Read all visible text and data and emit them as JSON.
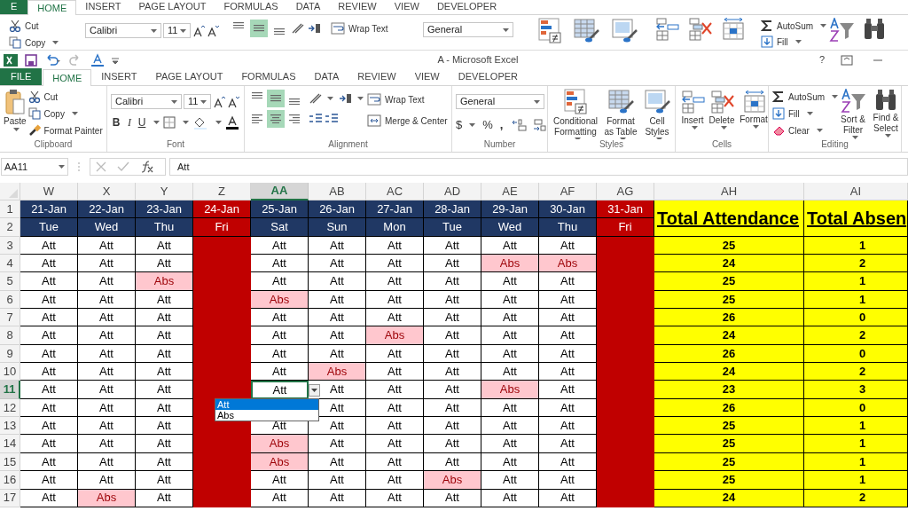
{
  "background_window": {
    "tabs": [
      {
        "label": "E",
        "kind": "file",
        "selected": false
      },
      {
        "label": "HOME",
        "selected": true
      },
      {
        "label": "INSERT",
        "selected": false
      },
      {
        "label": "PAGE LAYOUT",
        "selected": false
      },
      {
        "label": "FORMULAS",
        "selected": false
      },
      {
        "label": "DATA",
        "selected": false
      },
      {
        "label": "REVIEW",
        "selected": false
      },
      {
        "label": "VIEW",
        "selected": false
      },
      {
        "label": "DEVELOPER",
        "selected": false
      }
    ],
    "cut": "Cut",
    "copy": "Copy",
    "font_name": "Calibri",
    "font_size": "11",
    "wrap_text": "Wrap Text",
    "number_format": "General",
    "autosum": "AutoSum",
    "fill": "Fill"
  },
  "title_bar": {
    "title": "A - Microsoft Excel",
    "help": "?"
  },
  "ribbon": {
    "tabs": [
      {
        "label": "FILE",
        "kind": "file",
        "selected": false
      },
      {
        "label": "HOME",
        "selected": true
      },
      {
        "label": "INSERT",
        "selected": false
      },
      {
        "label": "PAGE LAYOUT",
        "selected": false
      },
      {
        "label": "FORMULAS",
        "selected": false
      },
      {
        "label": "DATA",
        "selected": false
      },
      {
        "label": "REVIEW",
        "selected": false
      },
      {
        "label": "VIEW",
        "selected": false
      },
      {
        "label": "DEVELOPER",
        "selected": false
      }
    ],
    "clipboard": {
      "label": "Clipboard",
      "paste": "Paste",
      "cut": "Cut",
      "copy": "Copy",
      "format_painter": "Format Painter"
    },
    "font": {
      "label": "Font",
      "font_name": "Calibri",
      "font_size": "11",
      "bold": "B",
      "italic": "I",
      "underline": "U"
    },
    "alignment": {
      "label": "Alignment",
      "wrap_text": "Wrap Text",
      "merge_center": "Merge & Center",
      "align_buttons": [
        {
          "kind": "top",
          "selected": false
        },
        {
          "kind": "middle",
          "selected": true
        },
        {
          "kind": "bottom",
          "selected": false
        },
        {
          "kind": "left",
          "selected": false
        },
        {
          "kind": "center",
          "selected": true
        },
        {
          "kind": "right",
          "selected": false
        }
      ]
    },
    "number": {
      "label": "Number",
      "format": "General",
      "currency": "$",
      "percent": "%",
      "comma": ","
    },
    "styles": {
      "label": "Styles",
      "conditional_formatting": "Conditional Formatting",
      "format_as_table": "Format as Table",
      "cell_styles": "Cell Styles"
    },
    "cells": {
      "label": "Cells",
      "insert": "Insert",
      "delete": "Delete",
      "format": "Format"
    },
    "editing": {
      "label": "Editing",
      "autosum": "AutoSum",
      "fill": "Fill",
      "clear": "Clear",
      "sort_filter": "Sort & Filter",
      "find_select": "Find & Select"
    }
  },
  "formula_bar": {
    "name_box": "AA11",
    "value": "Att"
  },
  "sheet": {
    "columns": [
      {
        "letter": "W",
        "date": "21-Jan",
        "day": "Tue",
        "holiday": false,
        "selected": false
      },
      {
        "letter": "X",
        "date": "22-Jan",
        "day": "Wed",
        "holiday": false,
        "selected": false
      },
      {
        "letter": "Y",
        "date": "23-Jan",
        "day": "Thu",
        "holiday": false,
        "selected": false
      },
      {
        "letter": "Z",
        "date": "24-Jan",
        "day": "Fri",
        "holiday": true,
        "selected": false
      },
      {
        "letter": "AA",
        "date": "25-Jan",
        "day": "Sat",
        "holiday": false,
        "selected": true
      },
      {
        "letter": "AB",
        "date": "26-Jan",
        "day": "Sun",
        "holiday": false,
        "selected": false
      },
      {
        "letter": "AC",
        "date": "27-Jan",
        "day": "Mon",
        "holiday": false,
        "selected": false
      },
      {
        "letter": "AD",
        "date": "28-Jan",
        "day": "Tue",
        "holiday": false,
        "selected": false
      },
      {
        "letter": "AE",
        "date": "29-Jan",
        "day": "Wed",
        "holiday": false,
        "selected": false
      },
      {
        "letter": "AF",
        "date": "30-Jan",
        "day": "Thu",
        "holiday": false,
        "selected": false
      },
      {
        "letter": "AG",
        "date": "31-Jan",
        "day": "Fri",
        "holiday": true,
        "selected": false
      }
    ],
    "total_columns": [
      {
        "letter": "AH",
        "title": "Total Attendance"
      },
      {
        "letter": "AI",
        "title": "Total Absen"
      }
    ],
    "header_row_numbers": [
      "1",
      "2"
    ],
    "rows": [
      {
        "number": "3",
        "selected": false,
        "cells": [
          "Att",
          "Att",
          "Att",
          "",
          "Att",
          "Att",
          "Att",
          "Att",
          "Att",
          "Att",
          ""
        ],
        "highlighted": [
          false,
          false,
          false,
          false,
          false,
          false,
          false,
          false,
          false,
          false,
          false
        ],
        "total_attendance": "25",
        "total_absent": "1"
      },
      {
        "number": "4",
        "selected": false,
        "cells": [
          "Att",
          "Att",
          "Att",
          "",
          "Att",
          "Att",
          "Att",
          "Att",
          "Abs",
          "Abs",
          ""
        ],
        "highlighted": [
          false,
          false,
          false,
          false,
          false,
          false,
          false,
          false,
          true,
          true,
          false
        ],
        "total_attendance": "24",
        "total_absent": "2"
      },
      {
        "number": "5",
        "selected": false,
        "cells": [
          "Att",
          "Att",
          "Abs",
          "",
          "Att",
          "Att",
          "Att",
          "Att",
          "Att",
          "Att",
          ""
        ],
        "highlighted": [
          false,
          false,
          true,
          false,
          false,
          false,
          false,
          false,
          false,
          false,
          false
        ],
        "total_attendance": "25",
        "total_absent": "1"
      },
      {
        "number": "6",
        "selected": false,
        "cells": [
          "Att",
          "Att",
          "Att",
          "",
          "Abs",
          "Att",
          "Att",
          "Att",
          "Att",
          "Att",
          ""
        ],
        "highlighted": [
          false,
          false,
          false,
          false,
          true,
          false,
          false,
          false,
          false,
          false,
          false
        ],
        "total_attendance": "25",
        "total_absent": "1"
      },
      {
        "number": "7",
        "selected": false,
        "cells": [
          "Att",
          "Att",
          "Att",
          "",
          "Att",
          "Att",
          "Att",
          "Att",
          "Att",
          "Att",
          ""
        ],
        "highlighted": [
          false,
          false,
          false,
          false,
          false,
          false,
          false,
          false,
          false,
          false,
          false
        ],
        "total_attendance": "26",
        "total_absent": "0"
      },
      {
        "number": "8",
        "selected": false,
        "cells": [
          "Att",
          "Att",
          "Att",
          "",
          "Att",
          "Att",
          "Abs",
          "Att",
          "Att",
          "Att",
          ""
        ],
        "highlighted": [
          false,
          false,
          false,
          false,
          false,
          false,
          true,
          false,
          false,
          false,
          false
        ],
        "total_attendance": "24",
        "total_absent": "2"
      },
      {
        "number": "9",
        "selected": false,
        "cells": [
          "Att",
          "Att",
          "Att",
          "",
          "Att",
          "Att",
          "Att",
          "Att",
          "Att",
          "Att",
          ""
        ],
        "highlighted": [
          false,
          false,
          false,
          false,
          false,
          false,
          false,
          false,
          false,
          false,
          false
        ],
        "total_attendance": "26",
        "total_absent": "0"
      },
      {
        "number": "10",
        "selected": false,
        "cells": [
          "Att",
          "Att",
          "Att",
          "",
          "Att",
          "Abs",
          "Att",
          "Att",
          "Att",
          "Att",
          ""
        ],
        "highlighted": [
          false,
          false,
          false,
          false,
          false,
          true,
          false,
          false,
          false,
          false,
          false
        ],
        "total_attendance": "24",
        "total_absent": "2"
      },
      {
        "number": "11",
        "selected": true,
        "cells": [
          "Att",
          "Att",
          "Att",
          "",
          "Att",
          "Att",
          "Att",
          "Att",
          "Abs",
          "Att",
          ""
        ],
        "highlighted": [
          false,
          false,
          false,
          false,
          false,
          false,
          false,
          false,
          true,
          false,
          false
        ],
        "total_attendance": "23",
        "total_absent": "3"
      },
      {
        "number": "12",
        "selected": false,
        "cells": [
          "Att",
          "Att",
          "Att",
          "",
          "",
          "Att",
          "Att",
          "Att",
          "Att",
          "Att",
          ""
        ],
        "highlighted": [
          false,
          false,
          false,
          false,
          false,
          false,
          false,
          false,
          false,
          false,
          false
        ],
        "total_attendance": "26",
        "total_absent": "0"
      },
      {
        "number": "13",
        "selected": false,
        "cells": [
          "Att",
          "Att",
          "Att",
          "",
          "Att",
          "Att",
          "Att",
          "Att",
          "Att",
          "Att",
          ""
        ],
        "highlighted": [
          false,
          false,
          false,
          false,
          false,
          false,
          false,
          false,
          false,
          false,
          false
        ],
        "total_attendance": "25",
        "total_absent": "1"
      },
      {
        "number": "14",
        "selected": false,
        "cells": [
          "Att",
          "Att",
          "Att",
          "",
          "Abs",
          "Att",
          "Att",
          "Att",
          "Att",
          "Att",
          ""
        ],
        "highlighted": [
          false,
          false,
          false,
          false,
          true,
          false,
          false,
          false,
          false,
          false,
          false
        ],
        "total_attendance": "25",
        "total_absent": "1"
      },
      {
        "number": "15",
        "selected": false,
        "cells": [
          "Att",
          "Att",
          "Att",
          "",
          "Abs",
          "Att",
          "Att",
          "Att",
          "Att",
          "Att",
          ""
        ],
        "highlighted": [
          false,
          false,
          false,
          false,
          true,
          false,
          false,
          false,
          false,
          false,
          false
        ],
        "total_attendance": "25",
        "total_absent": "1"
      },
      {
        "number": "16",
        "selected": false,
        "cells": [
          "Att",
          "Att",
          "Att",
          "",
          "Att",
          "Att",
          "Att",
          "Abs",
          "Att",
          "Att",
          ""
        ],
        "highlighted": [
          false,
          false,
          false,
          false,
          false,
          false,
          false,
          true,
          false,
          false,
          false
        ],
        "total_attendance": "25",
        "total_absent": "1"
      },
      {
        "number": "17",
        "selected": false,
        "cells": [
          "Att",
          "Abs",
          "Att",
          "",
          "Att",
          "Att",
          "Att",
          "Att",
          "Att",
          "Att",
          ""
        ],
        "highlighted": [
          false,
          true,
          false,
          false,
          false,
          false,
          false,
          false,
          false,
          false,
          false
        ],
        "total_attendance": "24",
        "total_absent": "2"
      }
    ],
    "dropdown": {
      "options": [
        {
          "label": "Att",
          "selected": true
        },
        {
          "label": "Abs",
          "selected": false
        }
      ]
    }
  }
}
